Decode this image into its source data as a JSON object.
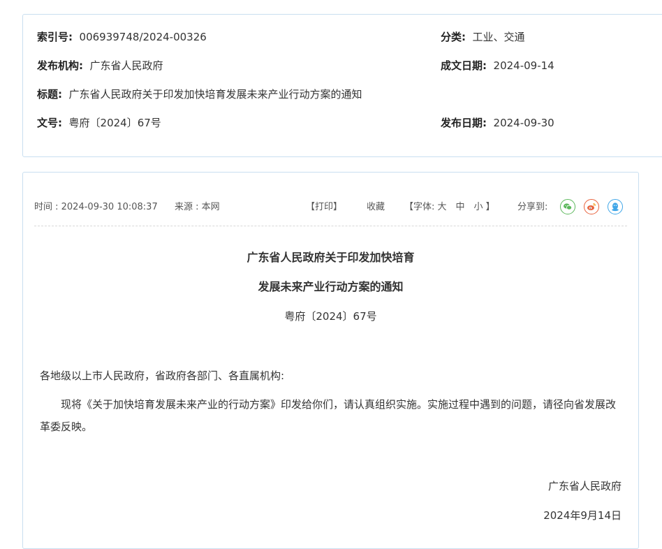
{
  "info": {
    "index_label": "索引号:",
    "index_value": "006939748/2024-00326",
    "category_label": "分类:",
    "category_value": "工业、交通",
    "issuer_label": "发布机构:",
    "issuer_value": "广东省人民政府",
    "written_date_label": "成文日期:",
    "written_date_value": "2024-09-14",
    "title_label": "标题:",
    "title_value": "广东省人民政府关于印发加快培育发展未来产业行动方案的通知",
    "doc_no_label": "文号:",
    "doc_no_value": "粤府〔2024〕67号",
    "publish_date_label": "发布日期:",
    "publish_date_value": "2024-09-30"
  },
  "meta": {
    "time": "时间 : 2024-09-30 10:08:37",
    "source": "来源 : 本网",
    "print": "【打印】",
    "favorite": "收藏",
    "font_label": "【字体: 大　中　小 】",
    "share_label": "分享到:",
    "share_icons": [
      "wechat-icon",
      "weibo-icon",
      "qq-icon"
    ],
    "colors": {
      "wechat": "#5cb85c",
      "weibo": "#e8613c",
      "qq": "#3fa6e8"
    }
  },
  "doc": {
    "title_line1": "广东省人民政府关于印发加快培育",
    "title_line2": "发展未来产业行动方案的通知",
    "number": "粤府〔2024〕67号",
    "salutation": "各地级以上市人民政府，省政府各部门、各直属机构:",
    "body": "　　现将《关于加快培育发展未来产业的行动方案》印发给你们，请认真组织实施。实施过程中遇到的问题，请径向省发展改革委反映。",
    "signer": "广东省人民政府",
    "sign_date": "2024年9月14日"
  }
}
